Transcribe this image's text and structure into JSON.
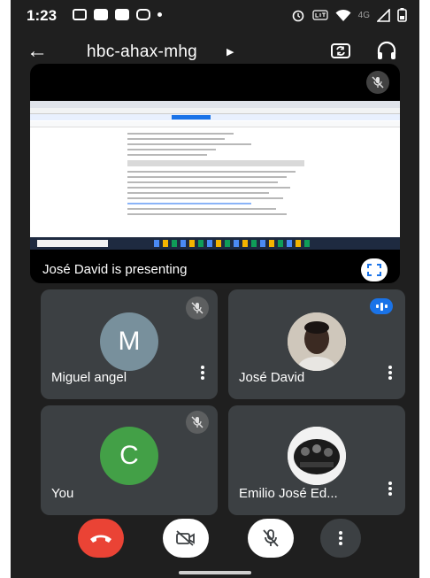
{
  "status_bar": {
    "time": "1:23",
    "network": "4G"
  },
  "app_bar": {
    "meeting_code": "hbc-ahax-mhg"
  },
  "presentation": {
    "presenting_text": "José David is presenting"
  },
  "participants": [
    {
      "name": "Miguel angel",
      "initial": "M",
      "avatar_color": "#78909c",
      "muted": true
    },
    {
      "name": "José David",
      "speaking": true
    },
    {
      "name": "You",
      "initial": "C",
      "avatar_color": "#43a047",
      "muted": true
    },
    {
      "name": "Emilio José Ed..."
    }
  ],
  "controls": {
    "end_call_color": "#ea4335"
  },
  "colors": {
    "background": "#1f1f1f",
    "tile": "#3c4043",
    "accent": "#1a73e8"
  }
}
